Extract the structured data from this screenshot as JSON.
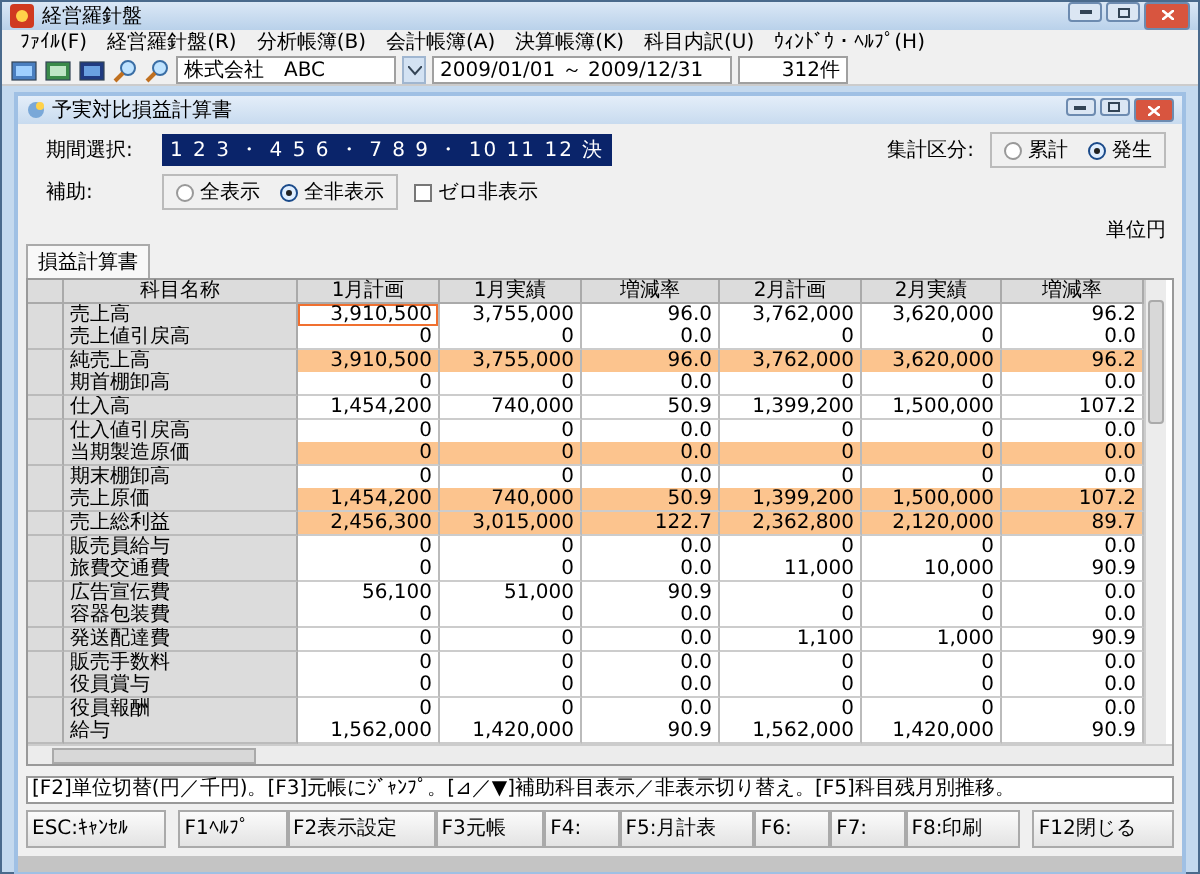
{
  "window": {
    "title": "経営羅針盤"
  },
  "menu": [
    "ﾌｧｲﾙ(F)",
    "経営羅針盤(R)",
    "分析帳簿(B)",
    "会計帳簿(A)",
    "決算帳簿(K)",
    "科目内訳(U)",
    "ｳｨﾝﾄﾞｳ・ﾍﾙﾌﾟ(H)"
  ],
  "toolbar": {
    "company": "株式会社　ABC",
    "period": "2009/01/01 ～ 2009/12/31",
    "count": "312件"
  },
  "child_window": {
    "title": "予実対比損益計算書"
  },
  "period_select": {
    "label": "期間選択:",
    "value": "1 2 3 ・ 4 5 6 ・ 7 8 9 ・ 10 11 12 決"
  },
  "aux": {
    "label": "補助:",
    "options": [
      {
        "label": "全表示",
        "selected": false
      },
      {
        "label": "全非表示",
        "selected": true
      }
    ],
    "zero_hide": {
      "label": "ゼロ非表示",
      "checked": false
    }
  },
  "aggregate": {
    "label": "集計区分:",
    "options": [
      {
        "label": "累計",
        "selected": false
      },
      {
        "label": "発生",
        "selected": true
      }
    ]
  },
  "unit": "単位円",
  "tabs": [
    {
      "label": "損益計算書",
      "selected": true
    }
  ],
  "table": {
    "columns": [
      "科目名称",
      "1月計画",
      "1月実績",
      "増減率",
      "2月計画",
      "2月実績",
      "増減率"
    ],
    "rows": [
      {
        "name": "売上高",
        "values": [
          "3,910,500",
          "3,755,000",
          "96.0",
          "3,762,000",
          "3,620,000",
          "96.2"
        ],
        "highlighted": false,
        "focused": true
      },
      {
        "name": "売上値引戻高",
        "values": [
          "0",
          "0",
          "0.0",
          "0",
          "0",
          "0.0"
        ],
        "highlighted": false,
        "focused": false
      },
      {
        "name": "純売上高",
        "values": [
          "3,910,500",
          "3,755,000",
          "96.0",
          "3,762,000",
          "3,620,000",
          "96.2"
        ],
        "highlighted": true,
        "focused": false
      },
      {
        "name": "期首棚卸高",
        "values": [
          "0",
          "0",
          "0.0",
          "0",
          "0",
          "0.0"
        ],
        "highlighted": false,
        "focused": false
      },
      {
        "name": "仕入高",
        "values": [
          "1,454,200",
          "740,000",
          "50.9",
          "1,399,200",
          "1,500,000",
          "107.2"
        ],
        "highlighted": false,
        "focused": false
      },
      {
        "name": "仕入値引戻高",
        "values": [
          "0",
          "0",
          "0.0",
          "0",
          "0",
          "0.0"
        ],
        "highlighted": false,
        "focused": false
      },
      {
        "name": "当期製造原価",
        "values": [
          "0",
          "0",
          "0.0",
          "0",
          "0",
          "0.0"
        ],
        "highlighted": true,
        "focused": false
      },
      {
        "name": "期末棚卸高",
        "values": [
          "0",
          "0",
          "0.0",
          "0",
          "0",
          "0.0"
        ],
        "highlighted": false,
        "focused": false
      },
      {
        "name": "売上原価",
        "values": [
          "1,454,200",
          "740,000",
          "50.9",
          "1,399,200",
          "1,500,000",
          "107.2"
        ],
        "highlighted": true,
        "focused": false
      },
      {
        "name": "売上総利益",
        "values": [
          "2,456,300",
          "3,015,000",
          "122.7",
          "2,362,800",
          "2,120,000",
          "89.7"
        ],
        "highlighted": true,
        "focused": false
      },
      {
        "name": "販売員給与",
        "values": [
          "0",
          "0",
          "0.0",
          "0",
          "0",
          "0.0"
        ],
        "highlighted": false,
        "focused": false
      },
      {
        "name": "旅費交通費",
        "values": [
          "0",
          "0",
          "0.0",
          "11,000",
          "10,000",
          "90.9"
        ],
        "highlighted": false,
        "focused": false
      },
      {
        "name": "広告宣伝費",
        "values": [
          "56,100",
          "51,000",
          "90.9",
          "0",
          "0",
          "0.0"
        ],
        "highlighted": false,
        "focused": false
      },
      {
        "name": "容器包装費",
        "values": [
          "0",
          "0",
          "0.0",
          "0",
          "0",
          "0.0"
        ],
        "highlighted": false,
        "focused": false
      },
      {
        "name": "発送配達費",
        "values": [
          "0",
          "0",
          "0.0",
          "1,100",
          "1,000",
          "90.9"
        ],
        "highlighted": false,
        "focused": false
      },
      {
        "name": "販売手数料",
        "values": [
          "0",
          "0",
          "0.0",
          "0",
          "0",
          "0.0"
        ],
        "highlighted": false,
        "focused": false
      },
      {
        "name": "役員賞与",
        "values": [
          "0",
          "0",
          "0.0",
          "0",
          "0",
          "0.0"
        ],
        "highlighted": false,
        "focused": false
      },
      {
        "name": "役員報酬",
        "values": [
          "0",
          "0",
          "0.0",
          "0",
          "0",
          "0.0"
        ],
        "highlighted": false,
        "focused": false
      },
      {
        "name": "給与",
        "values": [
          "1,562,000",
          "1,420,000",
          "90.9",
          "1,562,000",
          "1,420,000",
          "90.9"
        ],
        "highlighted": false,
        "focused": false
      }
    ]
  },
  "hint": "[F2]単位切替(円／千円)。[F3]元帳にｼﾞｬﾝﾌﾟ。[⊿／▼]補助科目表示／非表示切り替え。[F5]科目残月別推移。",
  "function_keys": [
    "ESC:ｷｬﾝｾﾙ",
    "F1ﾍﾙﾌﾟ",
    "F2表示設定",
    "F3元帳",
    "F4:",
    "F5:月計表",
    "F6:",
    "F7:",
    "F8:印刷",
    "F12閉じる"
  ]
}
